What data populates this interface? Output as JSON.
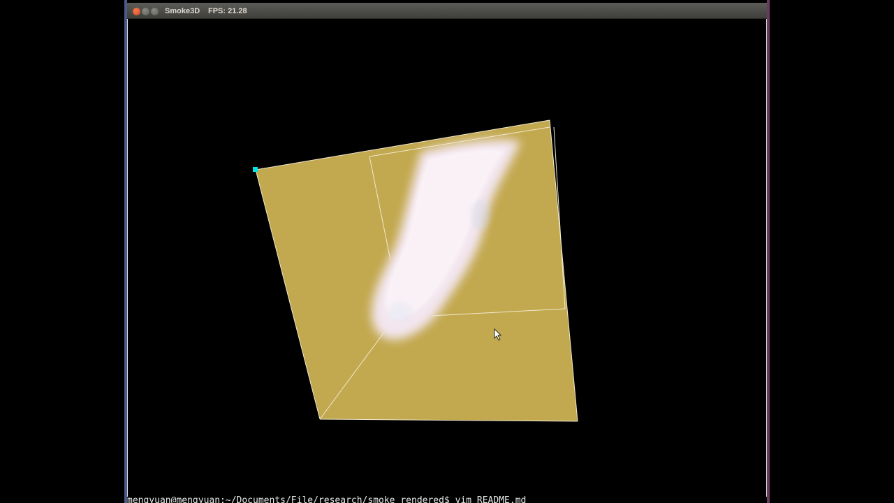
{
  "window": {
    "title": "Smoke3D",
    "fps_label": "FPS: 21.28"
  },
  "icons": {
    "close": "close-icon",
    "minimize": "minimize-icon",
    "maximize": "maximize-icon",
    "cursor": "mouse-pointer-icon"
  },
  "colors": {
    "box_face": "#c2a84e",
    "box_edge": "#f2ead0",
    "smoke": "#f5eaf0",
    "marker": "#00e5e5",
    "background": "#000000"
  },
  "terminal": {
    "prompt_line": "mengyuan@mengyuan:~/Documents/File/research/smoke_rendered$ vim README.md"
  }
}
